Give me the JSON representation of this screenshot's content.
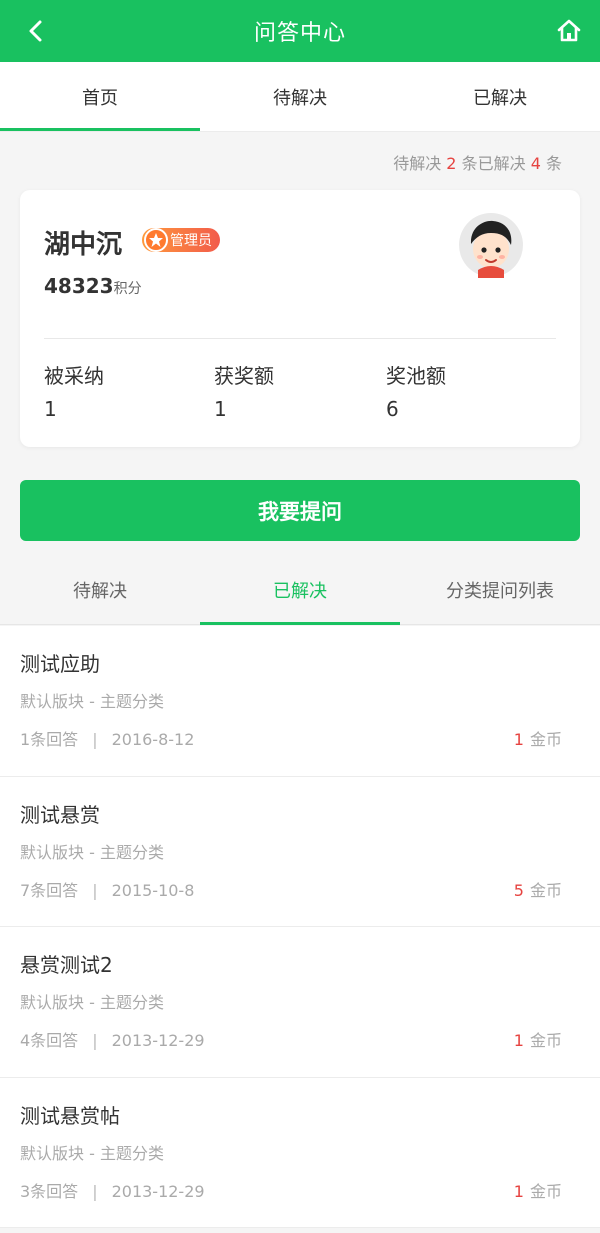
{
  "header": {
    "title": "问答中心",
    "back_icon": "chevron-left-icon",
    "home_icon": "home-icon"
  },
  "top_tabs": [
    {
      "label": "首页",
      "active": true
    },
    {
      "label": "待解决",
      "active": false
    },
    {
      "label": "已解决",
      "active": false
    }
  ],
  "summary": {
    "pending_prefix": "待解决",
    "pending_count": "2",
    "unit1": "条",
    "resolved_prefix": "已解决",
    "resolved_count": "4",
    "unit2": "条"
  },
  "profile": {
    "name": "湖中沉",
    "badge": "管理员",
    "points": "48323",
    "points_unit": "积分",
    "stats": [
      {
        "label": "被采纳",
        "value": "1"
      },
      {
        "label": "获奖额",
        "value": "1"
      },
      {
        "label": "奖池额",
        "value": "6"
      }
    ]
  },
  "ask_button": "我要提问",
  "sub_tabs": [
    {
      "label": "待解决",
      "active": false
    },
    {
      "label": "已解决",
      "active": true
    },
    {
      "label": "分类提问列表",
      "active": false
    }
  ],
  "questions": [
    {
      "title": "测试应助",
      "category": "默认版块 - 主题分类",
      "answers": "1条回答",
      "date": "2016-8-12",
      "reward": "1",
      "reward_unit": "金币"
    },
    {
      "title": "测试悬赏",
      "category": "默认版块 - 主题分类",
      "answers": "7条回答",
      "date": "2015-10-8",
      "reward": "5",
      "reward_unit": "金币"
    },
    {
      "title": "悬赏测试2",
      "category": "默认版块 - 主题分类",
      "answers": "4条回答",
      "date": "2013-12-29",
      "reward": "1",
      "reward_unit": "金币"
    },
    {
      "title": "测试悬赏帖",
      "category": "默认版块 - 主题分类",
      "answers": "3条回答",
      "date": "2013-12-29",
      "reward": "1",
      "reward_unit": "金币"
    }
  ],
  "colors": {
    "brand": "#19c160",
    "red": "#e64340",
    "muted": "#aaaaaa"
  }
}
